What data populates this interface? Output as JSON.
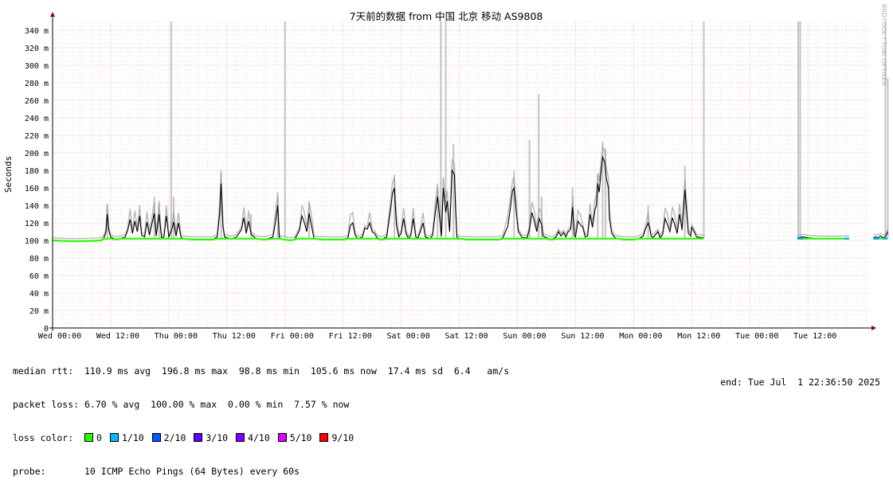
{
  "chart_data": {
    "type": "line",
    "title": "7天前的数据 from 中国 北京 移动 AS9808",
    "ylabel": "Seconds",
    "watermark": "RRDTOOL / TOBI OETIKER",
    "ylim": [
      0,
      350
    ],
    "y_unit_suffix": "m",
    "yticks": [
      {
        "v": 0,
        "label": "0"
      },
      {
        "v": 20,
        "label": "20 m"
      },
      {
        "v": 40,
        "label": "40 m"
      },
      {
        "v": 60,
        "label": "60 m"
      },
      {
        "v": 80,
        "label": "80 m"
      },
      {
        "v": 100,
        "label": "100 m"
      },
      {
        "v": 120,
        "label": "120 m"
      },
      {
        "v": 140,
        "label": "140 m"
      },
      {
        "v": 160,
        "label": "160 m"
      },
      {
        "v": 180,
        "label": "180 m"
      },
      {
        "v": 200,
        "label": "200 m"
      },
      {
        "v": 220,
        "label": "220 m"
      },
      {
        "v": 240,
        "label": "240 m"
      },
      {
        "v": 260,
        "label": "260 m"
      },
      {
        "v": 280,
        "label": "280 m"
      },
      {
        "v": 300,
        "label": "300 m"
      },
      {
        "v": 320,
        "label": "320 m"
      },
      {
        "v": 340,
        "label": "340 m"
      }
    ],
    "xlim_hours": [
      0,
      168.8
    ],
    "xticks": [
      {
        "h": 0,
        "label": "Wed 00:00"
      },
      {
        "h": 12,
        "label": "Wed 12:00"
      },
      {
        "h": 24,
        "label": "Thu 00:00"
      },
      {
        "h": 36,
        "label": "Thu 12:00"
      },
      {
        "h": 48,
        "label": "Fri 00:00"
      },
      {
        "h": 60,
        "label": "Fri 12:00"
      },
      {
        "h": 72,
        "label": "Sat 00:00"
      },
      {
        "h": 84,
        "label": "Sat 12:00"
      },
      {
        "h": 96,
        "label": "Sun 00:00"
      },
      {
        "h": 108,
        "label": "Sun 12:00"
      },
      {
        "h": 120,
        "label": "Mon 00:00"
      },
      {
        "h": 132,
        "label": "Mon 12:00"
      },
      {
        "h": 144,
        "label": "Tue 00:00"
      },
      {
        "h": 156,
        "label": "Tue 12:00"
      }
    ],
    "grid": true,
    "series": [
      {
        "name": "median rtt",
        "segments": [
          [
            [
              0,
              100
            ],
            [
              4,
              99
            ],
            [
              8,
              99.5
            ],
            [
              10,
              100
            ],
            [
              10.6,
              103
            ],
            [
              11,
              109
            ],
            [
              11.3,
              130
            ],
            [
              11.6,
              112
            ],
            [
              12,
              104
            ],
            [
              13,
              101
            ],
            [
              14,
              102
            ],
            [
              15,
              104
            ],
            [
              15.5,
              111
            ],
            [
              16,
              124
            ],
            [
              16.5,
              108
            ],
            [
              17,
              122
            ],
            [
              17.5,
              110
            ],
            [
              18,
              128
            ],
            [
              18.4,
              106
            ],
            [
              19,
              104
            ],
            [
              19.5,
              121
            ],
            [
              20,
              106
            ],
            [
              21,
              131
            ],
            [
              21.4,
              105
            ],
            [
              22,
              130
            ],
            [
              22.5,
              103
            ],
            [
              23,
              104
            ],
            [
              23.5,
              128
            ],
            [
              24,
              104
            ],
            [
              24.5,
              110
            ],
            [
              25,
              121
            ],
            [
              25.5,
              105
            ],
            [
              26,
              120
            ],
            [
              26.5,
              104
            ],
            [
              27,
              102
            ],
            [
              29,
              101
            ],
            [
              33,
              101
            ],
            [
              34,
              104
            ],
            [
              34.5,
              130
            ],
            [
              34.8,
              165
            ],
            [
              35.2,
              115
            ],
            [
              35.5,
              104
            ],
            [
              36,
              103
            ],
            [
              37,
              102
            ],
            [
              38,
              104
            ],
            [
              39,
              112
            ],
            [
              39.5,
              126
            ],
            [
              40,
              108
            ],
            [
              40.5,
              122
            ],
            [
              41,
              107
            ],
            [
              42,
              102
            ],
            [
              44,
              101
            ],
            [
              45.5,
              104
            ],
            [
              46,
              120
            ],
            [
              46.5,
              140
            ],
            [
              46.8,
              105
            ],
            [
              47,
              102
            ],
            [
              48,
              101
            ],
            [
              49,
              100
            ],
            [
              50,
              101
            ],
            [
              50.5,
              106
            ],
            [
              51,
              112
            ],
            [
              51.5,
              128
            ],
            [
              52,
              120
            ],
            [
              52.5,
              110
            ],
            [
              53,
              131
            ],
            [
              53.5,
              116
            ],
            [
              54,
              102
            ],
            [
              56,
              101
            ],
            [
              60,
              101
            ],
            [
              61,
              103
            ],
            [
              61.5,
              117
            ],
            [
              62,
              120
            ],
            [
              62.5,
              106
            ],
            [
              63,
              102
            ],
            [
              64,
              104
            ],
            [
              64.5,
              114
            ],
            [
              65,
              113
            ],
            [
              65.5,
              120
            ],
            [
              66,
              110
            ],
            [
              66.5,
              108
            ],
            [
              67,
              103
            ],
            [
              68,
              101
            ],
            [
              69,
              104
            ],
            [
              69.8,
              135
            ],
            [
              70.2,
              154
            ],
            [
              70.6,
              160
            ],
            [
              71,
              118
            ],
            [
              71.5,
              104
            ],
            [
              72,
              108
            ],
            [
              72.5,
              125
            ],
            [
              73,
              108
            ],
            [
              73.5,
              102
            ],
            [
              74,
              106
            ],
            [
              74.5,
              125
            ],
            [
              75,
              104
            ],
            [
              75.5,
              103
            ],
            [
              76,
              111
            ],
            [
              76.5,
              120
            ],
            [
              77,
              104
            ],
            [
              77.5,
              103
            ],
            [
              78,
              102
            ],
            [
              78.5,
              106
            ],
            [
              79,
              130
            ],
            [
              79.5,
              150
            ],
            [
              80,
              122
            ],
            [
              80.3,
              105
            ],
            [
              80.7,
              160
            ],
            [
              81.2,
              132
            ],
            [
              81.5,
              145
            ],
            [
              81.7,
              130
            ],
            [
              82,
              110
            ],
            [
              82.5,
              180
            ],
            [
              83,
              175
            ],
            [
              83.2,
              140
            ],
            [
              83.5,
              104
            ],
            [
              84,
              102
            ],
            [
              86,
              101
            ],
            [
              90,
              101
            ],
            [
              92,
              101
            ],
            [
              93,
              103
            ],
            [
              94,
              116
            ],
            [
              94.5,
              135
            ],
            [
              95,
              157
            ],
            [
              95.3,
              160
            ],
            [
              95.8,
              130
            ],
            [
              96.2,
              110
            ],
            [
              97,
              103
            ],
            [
              98,
              103
            ],
            [
              98.5,
              113
            ],
            [
              99,
              132
            ],
            [
              99.5,
              122
            ],
            [
              100,
              110
            ],
            [
              100.5,
              125
            ],
            [
              101,
              118
            ],
            [
              101.3,
              105
            ],
            [
              102,
              103
            ],
            [
              103,
              101
            ],
            [
              104,
              104
            ],
            [
              104.5,
              110
            ],
            [
              105,
              105
            ],
            [
              105.5,
              109
            ],
            [
              106,
              104
            ],
            [
              106.5,
              110
            ],
            [
              107,
              113
            ],
            [
              107.4,
              138
            ],
            [
              107.8,
              105
            ],
            [
              108,
              104
            ],
            [
              108.5,
              122
            ],
            [
              109,
              118
            ],
            [
              109.5,
              115
            ],
            [
              110,
              104
            ],
            [
              110.5,
              105
            ],
            [
              111,
              130
            ],
            [
              111.5,
              115
            ],
            [
              112,
              135
            ],
            [
              112.3,
              140
            ],
            [
              112.6,
              165
            ],
            [
              112.9,
              155
            ],
            [
              113.2,
              175
            ],
            [
              113.6,
              195
            ],
            [
              114,
              190
            ],
            [
              114.4,
              170
            ],
            [
              114.8,
              160
            ],
            [
              115,
              125
            ],
            [
              115.5,
              108
            ],
            [
              116,
              104
            ],
            [
              116.5,
              102
            ],
            [
              117,
              102
            ],
            [
              118,
              101
            ],
            [
              120,
              101
            ],
            [
              121,
              102
            ],
            [
              122,
              105
            ],
            [
              122.5,
              114
            ],
            [
              123,
              120
            ],
            [
              123.3,
              115
            ],
            [
              123.6,
              105
            ],
            [
              124,
              103
            ],
            [
              125,
              110
            ],
            [
              125.5,
              103
            ],
            [
              126,
              107
            ],
            [
              126.5,
              125
            ],
            [
              127,
              118
            ],
            [
              127.5,
              110
            ],
            [
              128,
              126
            ],
            [
              128.5,
              118
            ],
            [
              129,
              108
            ],
            [
              129.5,
              130
            ],
            [
              130,
              112
            ],
            [
              130.3,
              135
            ],
            [
              130.6,
              158
            ],
            [
              131,
              130
            ],
            [
              131.3,
              108
            ],
            [
              131.8,
              105
            ],
            [
              132,
              115
            ],
            [
              132.5,
              110
            ],
            [
              133,
              104
            ],
            [
              134,
              103
            ],
            [
              134.5,
              103
            ]
          ],
          [
            [
              153.8,
              103
            ],
            [
              154,
              103
            ],
            [
              155,
              104
            ],
            [
              156,
              103
            ],
            [
              158,
              102
            ],
            [
              160,
              102
            ],
            [
              164,
              102
            ],
            [
              164.5,
              102
            ]
          ],
          [
            [
              169.5,
              103
            ],
            [
              170,
              104
            ],
            [
              170.5,
              103
            ],
            [
              171,
              105
            ],
            [
              171.5,
              103
            ],
            [
              172,
              104
            ],
            [
              172.5,
              110
            ]
          ]
        ]
      }
    ],
    "smoke_spikes": [
      {
        "h": 11.3,
        "top": 140
      },
      {
        "h": 21,
        "top": 150
      },
      {
        "h": 22,
        "top": 145
      },
      {
        "h": 24.5,
        "top": 350
      },
      {
        "h": 25,
        "top": 150
      },
      {
        "h": 34.8,
        "top": 180
      },
      {
        "h": 41,
        "top": 130
      },
      {
        "h": 46.5,
        "top": 155
      },
      {
        "h": 48,
        "top": 350
      },
      {
        "h": 53,
        "top": 145
      },
      {
        "h": 70.6,
        "top": 175
      },
      {
        "h": 79.5,
        "top": 165
      },
      {
        "h": 80.2,
        "top": 350
      },
      {
        "h": 81.2,
        "top": 350
      },
      {
        "h": 82.8,
        "top": 210
      },
      {
        "h": 95.3,
        "top": 180
      },
      {
        "h": 98.5,
        "top": 215
      },
      {
        "h": 100.4,
        "top": 267
      },
      {
        "h": 101,
        "top": 150
      },
      {
        "h": 107.4,
        "top": 160
      },
      {
        "h": 112.6,
        "top": 175
      },
      {
        "h": 113.6,
        "top": 213
      },
      {
        "h": 114.2,
        "top": 205
      },
      {
        "h": 123,
        "top": 140
      },
      {
        "h": 130.6,
        "top": 185
      },
      {
        "h": 134.5,
        "top": 350
      },
      {
        "h": 154,
        "top": 350
      },
      {
        "h": 154.4,
        "top": 350
      },
      {
        "h": 172,
        "top": 350
      },
      {
        "h": 172.5,
        "top": 285
      }
    ],
    "spike_peaks": [
      {
        "h": 172.5,
        "top": 285
      }
    ]
  },
  "stats": {
    "median_rtt": "median rtt:  110.9 ms avg  196.8 ms max  98.8 ms min  105.6 ms now  17.4 ms sd  6.4   am/s",
    "packet_loss": "packet loss: 6.70 % avg  100.00 % max  0.00 % min  7.57 % now",
    "loss_color_label": "loss color:",
    "loss_legend": [
      {
        "label": "0",
        "color": "#26ff00"
      },
      {
        "label": "1/10",
        "color": "#00b8ff"
      },
      {
        "label": "2/10",
        "color": "#0059ff"
      },
      {
        "label": "3/10",
        "color": "#5e00ff"
      },
      {
        "label": "4/10",
        "color": "#7e00ff"
      },
      {
        "label": "5/10",
        "color": "#dd00ff"
      },
      {
        "label": "9/10",
        "color": "#ff0000"
      }
    ],
    "probe": "probe:       10 ICMP Echo Pings (64 Bytes) every 60s",
    "end": "end: Tue Jul  1 22:36:50 2025"
  }
}
